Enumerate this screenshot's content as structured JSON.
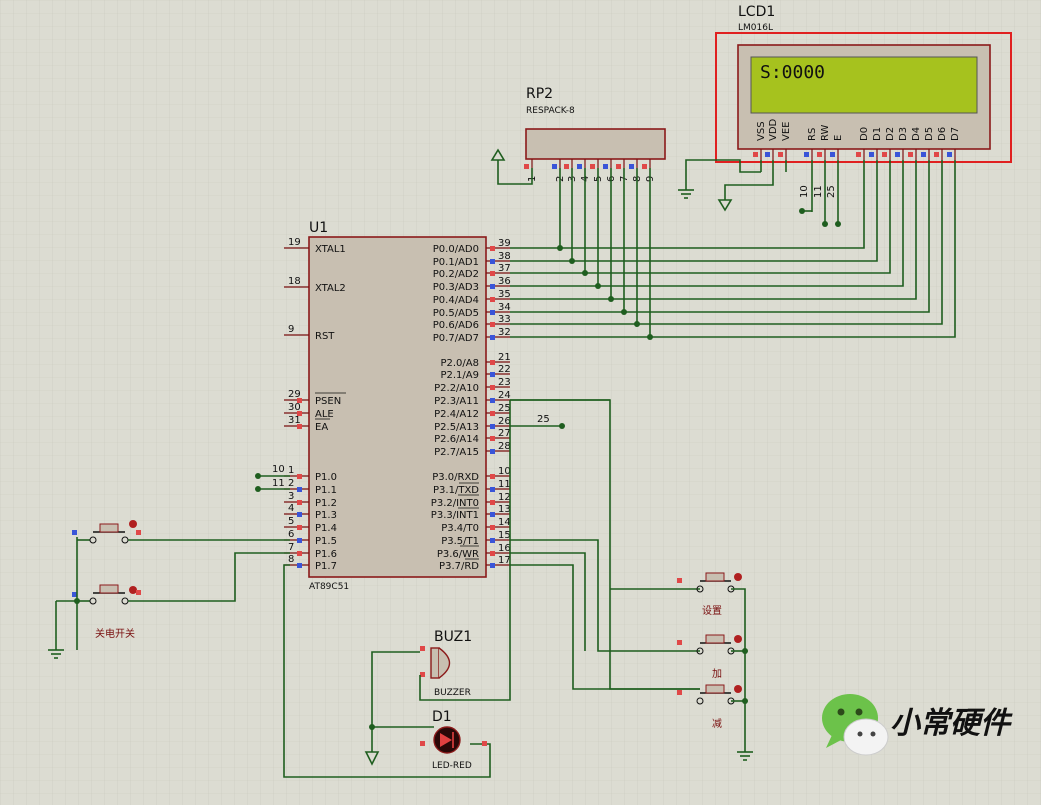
{
  "lcd": {
    "ref": "LCD1",
    "part": "LM016L",
    "screen_text": "S:0000",
    "pins": [
      "VSS",
      "VDD",
      "VEE",
      "RS",
      "RW",
      "E",
      "D0",
      "D1",
      "D2",
      "D3",
      "D4",
      "D5",
      "D6",
      "D7"
    ],
    "ctrl_pin_numbers": [
      "10",
      "11",
      "25"
    ]
  },
  "rp2": {
    "ref": "RP2",
    "part": "RESPACK-8",
    "pins": [
      "1",
      "2",
      "3",
      "4",
      "5",
      "6",
      "7",
      "8",
      "9"
    ]
  },
  "u1": {
    "ref": "U1",
    "part": "AT89C51",
    "left_pins": [
      {
        "num": "19",
        "name": "XTAL1"
      },
      {
        "num": "18",
        "name": "XTAL2"
      },
      {
        "num": "9",
        "name": "RST"
      },
      {
        "num": "29",
        "name": "PSEN"
      },
      {
        "num": "30",
        "name": "ALE"
      },
      {
        "num": "31",
        "name": "EA"
      },
      {
        "num": "1",
        "name": "P1.0"
      },
      {
        "num": "2",
        "name": "P1.1"
      },
      {
        "num": "3",
        "name": "P1.2"
      },
      {
        "num": "4",
        "name": "P1.3"
      },
      {
        "num": "5",
        "name": "P1.4"
      },
      {
        "num": "6",
        "name": "P1.5"
      },
      {
        "num": "7",
        "name": "P1.6"
      },
      {
        "num": "8",
        "name": "P1.7"
      }
    ],
    "right_pins": [
      {
        "num": "39",
        "name": "P0.0/AD0"
      },
      {
        "num": "38",
        "name": "P0.1/AD1"
      },
      {
        "num": "37",
        "name": "P0.2/AD2"
      },
      {
        "num": "36",
        "name": "P0.3/AD3"
      },
      {
        "num": "35",
        "name": "P0.4/AD4"
      },
      {
        "num": "34",
        "name": "P0.5/AD5"
      },
      {
        "num": "33",
        "name": "P0.6/AD6"
      },
      {
        "num": "32",
        "name": "P0.7/AD7"
      },
      {
        "num": "21",
        "name": "P2.0/A8"
      },
      {
        "num": "22",
        "name": "P2.1/A9"
      },
      {
        "num": "23",
        "name": "P2.2/A10"
      },
      {
        "num": "24",
        "name": "P2.3/A11"
      },
      {
        "num": "25",
        "name": "P2.4/A12"
      },
      {
        "num": "26",
        "name": "P2.5/A13"
      },
      {
        "num": "27",
        "name": "P2.6/A14"
      },
      {
        "num": "28",
        "name": "P2.7/A15"
      },
      {
        "num": "10",
        "name": "P3.0/RXD"
      },
      {
        "num": "11",
        "name": "P3.1/TXD"
      },
      {
        "num": "12",
        "name": "P3.2/INT0"
      },
      {
        "num": "13",
        "name": "P3.3/INT1"
      },
      {
        "num": "14",
        "name": "P3.4/T0"
      },
      {
        "num": "15",
        "name": "P3.5/T1"
      },
      {
        "num": "16",
        "name": "P3.6/WR"
      },
      {
        "num": "17",
        "name": "P3.7/RD"
      }
    ],
    "left_net_labels": [
      "10",
      "11"
    ],
    "right_net_label": "25"
  },
  "buz1": {
    "ref": "BUZ1",
    "part": "BUZZER"
  },
  "d1": {
    "ref": "D1",
    "part": "LED-RED"
  },
  "switch_labels": {
    "power": "关电开关",
    "set": "设置",
    "plus": "加",
    "minus": "减"
  },
  "watermark": {
    "text": "小常硬件"
  },
  "colors": {
    "background": "#dcdcd2",
    "wire": "#1f5e1f",
    "component_body": "#c8bfb1",
    "component_border": "#8b1a1a",
    "lcd_screen": "#a6c21e",
    "highlight_box": "#e02020",
    "pin_red": "#e04848",
    "pin_blue": "#3a55d8"
  }
}
